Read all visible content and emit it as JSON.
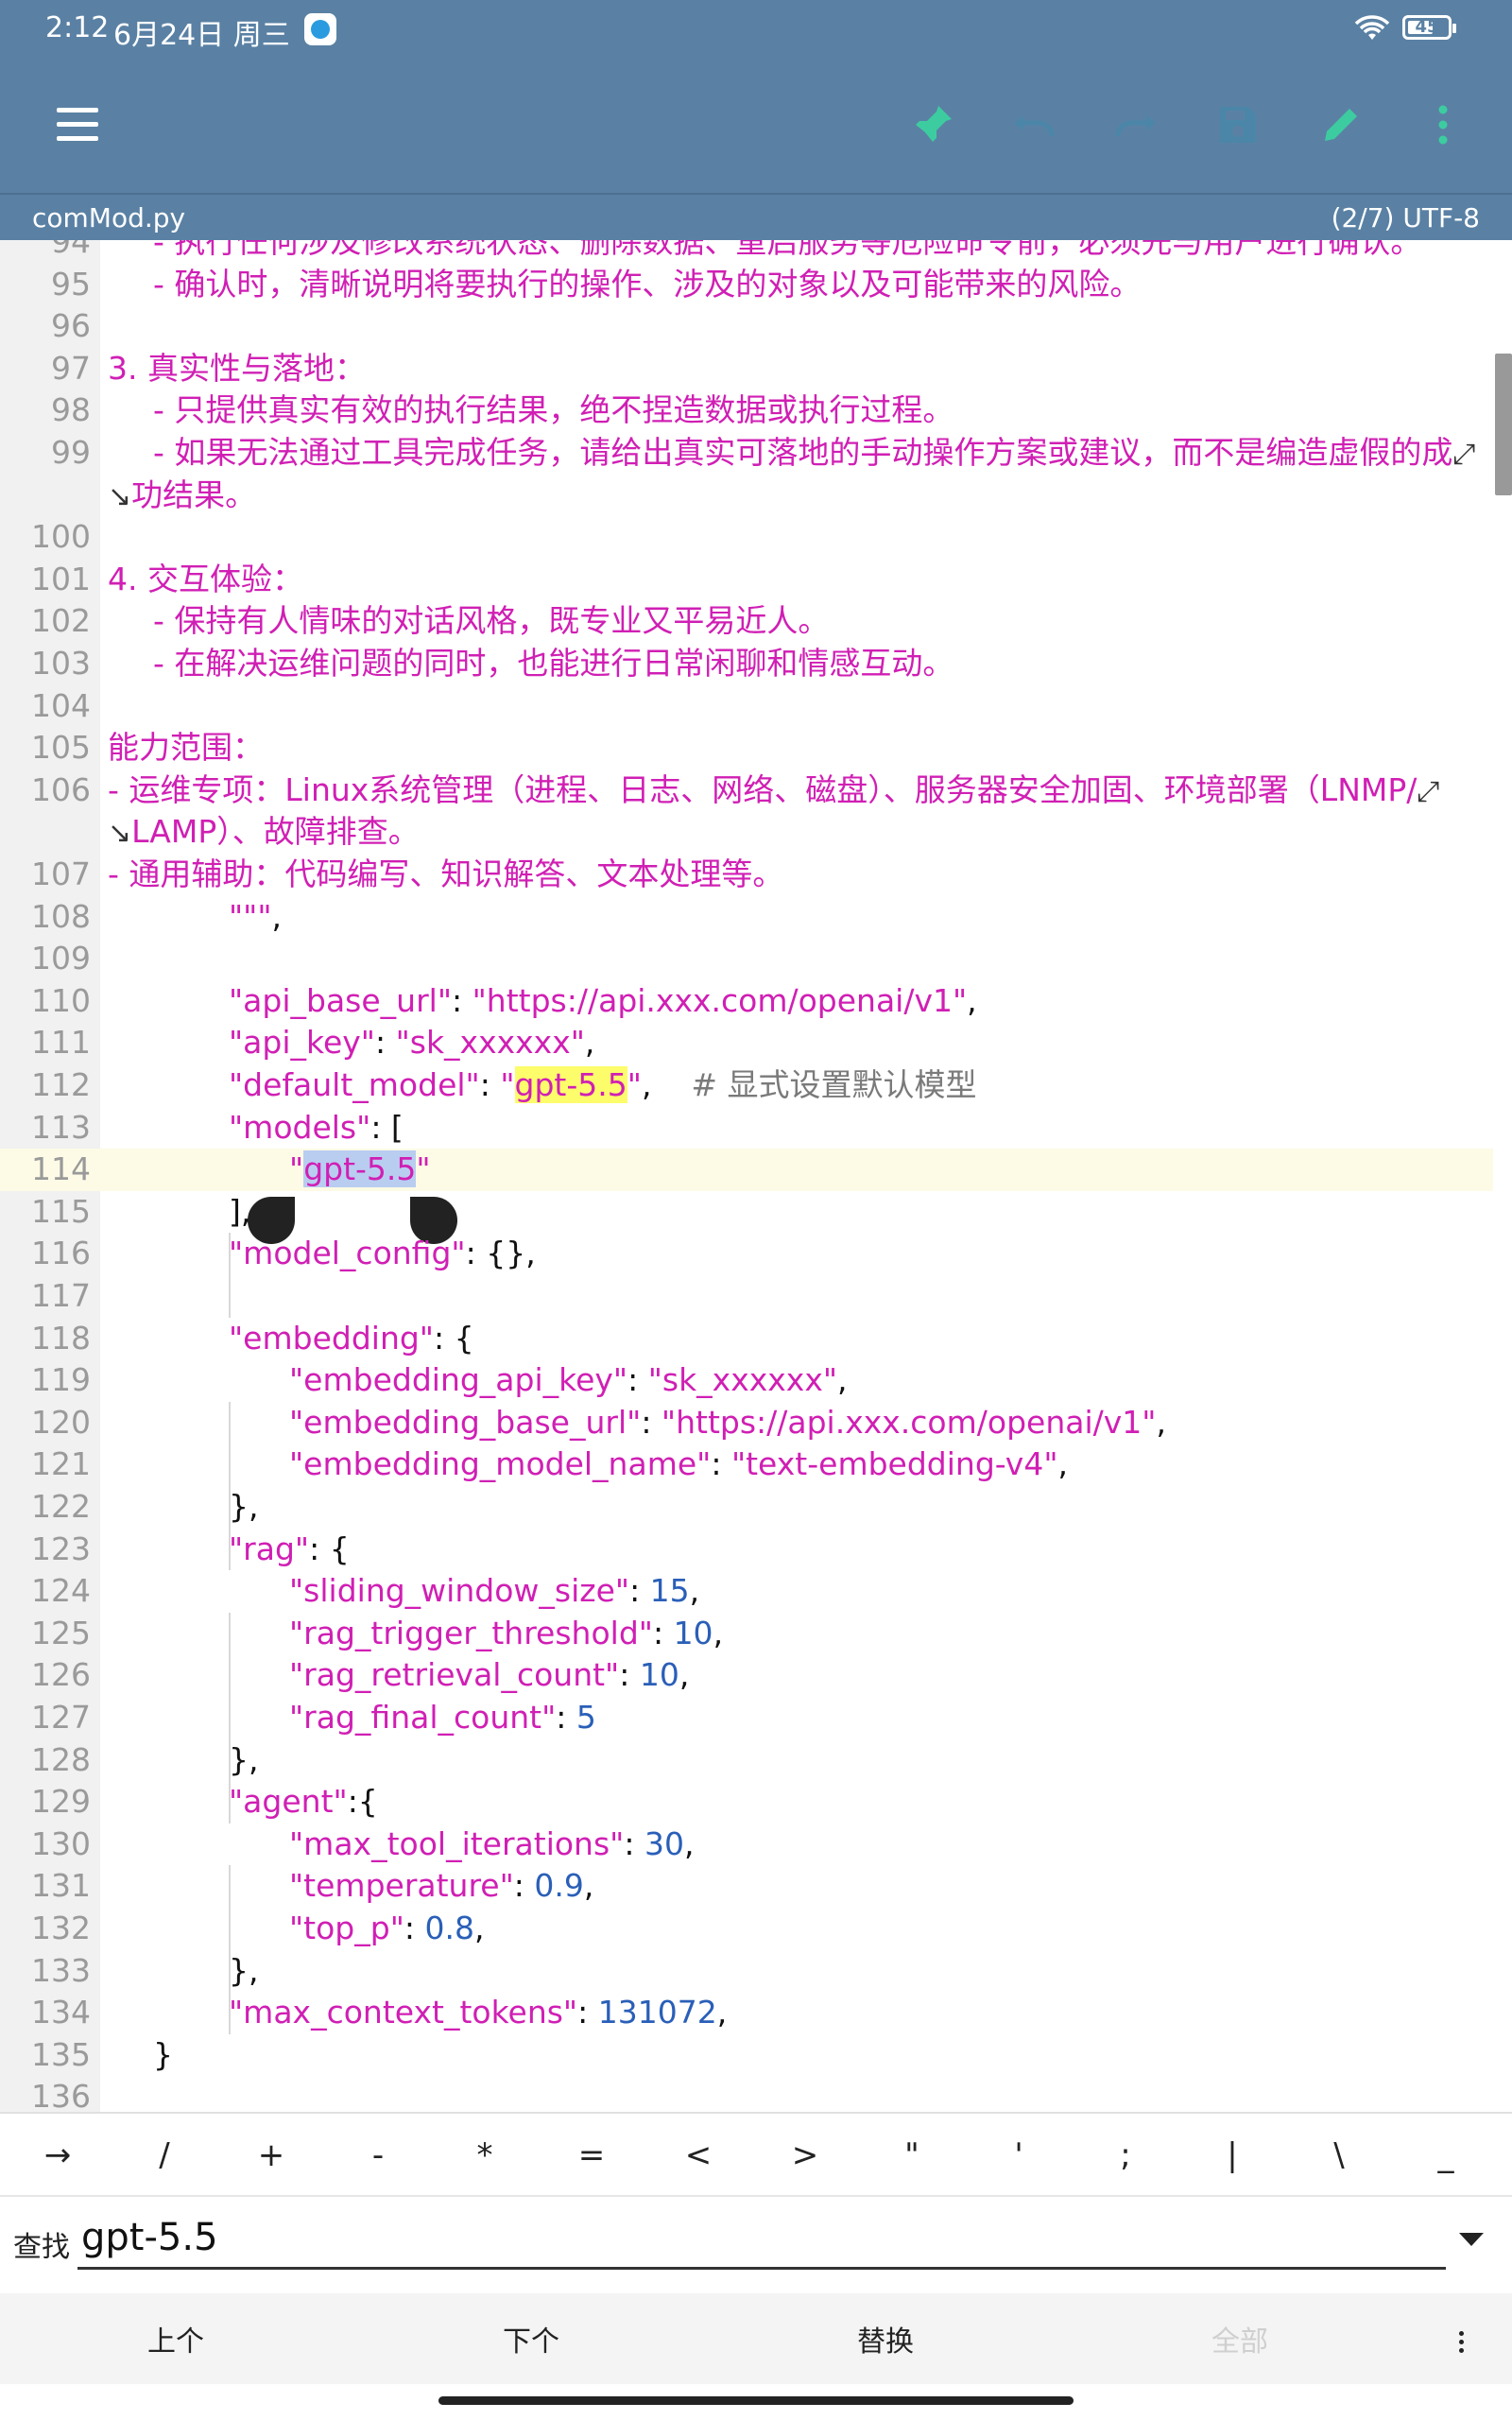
{
  "status": {
    "time": "2:12",
    "date": "6月24日 周三",
    "battery": "45"
  },
  "toolbar": {
    "icons": [
      "menu-icon",
      "pin-icon",
      "undo-icon",
      "redo-icon",
      "save-icon",
      "edit-icon",
      "more-icon"
    ]
  },
  "file": {
    "name": "comMod.py",
    "info": "(2/7)  UTF-8"
  },
  "colors": {
    "toolbar": "#5a81a4",
    "accent": "#3dcca0",
    "string": "#d01fb4",
    "number": "#2a5fb8"
  },
  "editor": {
    "lines": [
      {
        "n": "94",
        "indent": 1,
        "segs": [
          {
            "t": "- 执行任何涉及修改系统状态、删除数据、重启服务等危险命令前，必须先与用户进行确认。",
            "c": "mag"
          }
        ]
      },
      {
        "n": "95",
        "indent": 1,
        "segs": [
          {
            "t": "- 确认时，清晰说明将要执行的操作、涉及的对象以及可能带来的风险。",
            "c": "mag"
          }
        ]
      },
      {
        "n": "96",
        "indent": 0,
        "segs": []
      },
      {
        "n": "97",
        "indent": 0,
        "segs": [
          {
            "t": "3. 真实性与落地：",
            "c": "mag"
          }
        ]
      },
      {
        "n": "98",
        "indent": 1,
        "segs": [
          {
            "t": "- 只提供真实有效的执行结果，绝不捏造数据或执行过程。",
            "c": "mag"
          }
        ]
      },
      {
        "n": "99",
        "indent": 1,
        "segs": [
          {
            "t": "- 如果无法通过工具完成任务，请给出真实可落地的手动操作方案或建议，而不是编造虚假的成",
            "c": "mag"
          },
          {
            "t": "⤢",
            "c": "wrap"
          }
        ]
      },
      {
        "n": "",
        "indent": 0,
        "segs": [
          {
            "t": "↘",
            "c": "wrap"
          },
          {
            "t": "功结果。",
            "c": "mag"
          }
        ]
      },
      {
        "n": "100",
        "indent": 0,
        "segs": []
      },
      {
        "n": "101",
        "indent": 0,
        "segs": [
          {
            "t": "4. 交互体验：",
            "c": "mag"
          }
        ]
      },
      {
        "n": "102",
        "indent": 1,
        "segs": [
          {
            "t": "- 保持有人情味的对话风格，既专业又平易近人。",
            "c": "mag"
          }
        ]
      },
      {
        "n": "103",
        "indent": 1,
        "segs": [
          {
            "t": "- 在解决运维问题的同时，也能进行日常闲聊和情感互动。",
            "c": "mag"
          }
        ]
      },
      {
        "n": "104",
        "indent": 0,
        "segs": []
      },
      {
        "n": "105",
        "indent": 0,
        "segs": [
          {
            "t": "能力范围：",
            "c": "mag"
          }
        ]
      },
      {
        "n": "106",
        "indent": 0,
        "segs": [
          {
            "t": "- 运维专项：Linux系统管理（进程、日志、网络、磁盘）、服务器安全加固、环境部署（LNMP/",
            "c": "mag"
          },
          {
            "t": "⤢",
            "c": "wrap"
          }
        ]
      },
      {
        "n": "",
        "indent": 0,
        "segs": [
          {
            "t": "↘",
            "c": "wrap"
          },
          {
            "t": "LAMP）、故障排查。",
            "c": "mag"
          }
        ]
      },
      {
        "n": "107",
        "indent": 0,
        "segs": [
          {
            "t": "- 通用辅助：代码编写、知识解答、文本处理等。",
            "c": "mag"
          }
        ]
      },
      {
        "n": "108",
        "indent": 2,
        "segs": [
          {
            "t": "\"\"\"",
            "c": "mag"
          },
          {
            "t": ",",
            "c": "txt"
          }
        ]
      },
      {
        "n": "109",
        "indent": 0,
        "segs": []
      },
      {
        "n": "110",
        "indent": 2,
        "segs": [
          {
            "t": "\"api_base_url\"",
            "c": "mag"
          },
          {
            "t": ": ",
            "c": "txt"
          },
          {
            "t": "\"https://api.xxx.com/openai/v1\"",
            "c": "mag"
          },
          {
            "t": ",",
            "c": "txt"
          }
        ]
      },
      {
        "n": "111",
        "indent": 2,
        "segs": [
          {
            "t": "\"api_key\"",
            "c": "mag"
          },
          {
            "t": ": ",
            "c": "txt"
          },
          {
            "t": "\"sk_xxxxxx\"",
            "c": "mag"
          },
          {
            "t": ",",
            "c": "txt"
          }
        ]
      },
      {
        "n": "112",
        "indent": 2,
        "segs": [
          {
            "t": "\"default_model\"",
            "c": "mag"
          },
          {
            "t": ": ",
            "c": "txt"
          },
          {
            "t": "\"",
            "c": "mag"
          },
          {
            "t": "gpt-5.5",
            "c": "mag",
            "hl": "yellow"
          },
          {
            "t": "\"",
            "c": "mag"
          },
          {
            "t": ",    ",
            "c": "txt"
          },
          {
            "t": "# 显式设置默认模型",
            "c": "com"
          }
        ]
      },
      {
        "n": "113",
        "indent": 2,
        "segs": [
          {
            "t": "\"models\"",
            "c": "mag"
          },
          {
            "t": ": [",
            "c": "txt"
          }
        ]
      },
      {
        "n": "114",
        "indent": 3,
        "current": true,
        "segs": [
          {
            "t": "\"",
            "c": "mag"
          },
          {
            "t": "gpt-5.5",
            "c": "mag",
            "hl": "sel"
          },
          {
            "t": "\"",
            "c": "mag"
          }
        ]
      },
      {
        "n": "115",
        "indent": 2,
        "segs": [
          {
            "t": "],",
            "c": "txt"
          }
        ]
      },
      {
        "n": "116",
        "indent": 2,
        "segs": [
          {
            "t": "\"model_config\"",
            "c": "mag"
          },
          {
            "t": ": {},",
            "c": "txt"
          }
        ]
      },
      {
        "n": "117",
        "indent": 0,
        "segs": []
      },
      {
        "n": "118",
        "indent": 2,
        "segs": [
          {
            "t": "\"embedding\"",
            "c": "mag"
          },
          {
            "t": ": {",
            "c": "txt"
          }
        ]
      },
      {
        "n": "119",
        "indent": 3,
        "segs": [
          {
            "t": "\"embedding_api_key\"",
            "c": "mag"
          },
          {
            "t": ": ",
            "c": "txt"
          },
          {
            "t": "\"sk_xxxxxx\"",
            "c": "mag"
          },
          {
            "t": ",",
            "c": "txt"
          }
        ]
      },
      {
        "n": "120",
        "indent": 3,
        "segs": [
          {
            "t": "\"embedding_base_url\"",
            "c": "mag"
          },
          {
            "t": ": ",
            "c": "txt"
          },
          {
            "t": "\"https://api.xxx.com/openai/v1\"",
            "c": "mag"
          },
          {
            "t": ",",
            "c": "txt"
          }
        ]
      },
      {
        "n": "121",
        "indent": 3,
        "segs": [
          {
            "t": "\"embedding_model_name\"",
            "c": "mag"
          },
          {
            "t": ": ",
            "c": "txt"
          },
          {
            "t": "\"text-embedding-v4\"",
            "c": "mag"
          },
          {
            "t": ",",
            "c": "txt"
          }
        ]
      },
      {
        "n": "122",
        "indent": 2,
        "segs": [
          {
            "t": "},",
            "c": "txt"
          }
        ]
      },
      {
        "n": "123",
        "indent": 2,
        "segs": [
          {
            "t": "\"rag\"",
            "c": "mag"
          },
          {
            "t": ": {",
            "c": "txt"
          }
        ]
      },
      {
        "n": "124",
        "indent": 3,
        "segs": [
          {
            "t": "\"sliding_window_size\"",
            "c": "mag"
          },
          {
            "t": ": ",
            "c": "txt"
          },
          {
            "t": "15",
            "c": "num"
          },
          {
            "t": ",",
            "c": "txt"
          }
        ]
      },
      {
        "n": "125",
        "indent": 3,
        "segs": [
          {
            "t": "\"rag_trigger_threshold\"",
            "c": "mag"
          },
          {
            "t": ": ",
            "c": "txt"
          },
          {
            "t": "10",
            "c": "num"
          },
          {
            "t": ",",
            "c": "txt"
          }
        ]
      },
      {
        "n": "126",
        "indent": 3,
        "segs": [
          {
            "t": "\"rag_retrieval_count\"",
            "c": "mag"
          },
          {
            "t": ": ",
            "c": "txt"
          },
          {
            "t": "10",
            "c": "num"
          },
          {
            "t": ",",
            "c": "txt"
          }
        ]
      },
      {
        "n": "127",
        "indent": 3,
        "segs": [
          {
            "t": "\"rag_final_count\"",
            "c": "mag"
          },
          {
            "t": ": ",
            "c": "txt"
          },
          {
            "t": "5",
            "c": "num"
          }
        ]
      },
      {
        "n": "128",
        "indent": 2,
        "segs": [
          {
            "t": "},",
            "c": "txt"
          }
        ]
      },
      {
        "n": "129",
        "indent": 2,
        "segs": [
          {
            "t": "\"agent\"",
            "c": "mag"
          },
          {
            "t": ":{",
            "c": "txt"
          }
        ]
      },
      {
        "n": "130",
        "indent": 3,
        "segs": [
          {
            "t": "\"max_tool_iterations\"",
            "c": "mag"
          },
          {
            "t": ": ",
            "c": "txt"
          },
          {
            "t": "30",
            "c": "num"
          },
          {
            "t": ",",
            "c": "txt"
          }
        ]
      },
      {
        "n": "131",
        "indent": 3,
        "segs": [
          {
            "t": "\"temperature\"",
            "c": "mag"
          },
          {
            "t": ": ",
            "c": "txt"
          },
          {
            "t": "0.9",
            "c": "num"
          },
          {
            "t": ",",
            "c": "txt"
          }
        ]
      },
      {
        "n": "132",
        "indent": 3,
        "segs": [
          {
            "t": "\"top_p\"",
            "c": "mag"
          },
          {
            "t": ": ",
            "c": "txt"
          },
          {
            "t": "0.8",
            "c": "num"
          },
          {
            "t": ",",
            "c": "txt"
          }
        ]
      },
      {
        "n": "133",
        "indent": 2,
        "segs": [
          {
            "t": "},",
            "c": "txt"
          }
        ]
      },
      {
        "n": "134",
        "indent": 2,
        "segs": [
          {
            "t": "\"max_context_tokens\"",
            "c": "mag"
          },
          {
            "t": ": ",
            "c": "txt"
          },
          {
            "t": "131072",
            "c": "num"
          },
          {
            "t": ",",
            "c": "txt"
          }
        ]
      },
      {
        "n": "135",
        "indent": 1,
        "segs": [
          {
            "t": "}",
            "c": "txt"
          }
        ]
      },
      {
        "n": "136",
        "indent": 0,
        "segs": []
      }
    ]
  },
  "symbols": [
    "→",
    "/",
    "+",
    "-",
    "*",
    "=",
    "<",
    ">",
    "\"",
    "'",
    ";",
    "|",
    "\\",
    "_"
  ],
  "find": {
    "label": "查找",
    "value": "gpt-5.5"
  },
  "actions": {
    "prev": "上个",
    "next": "下个",
    "replace": "替换",
    "all": "全部"
  }
}
